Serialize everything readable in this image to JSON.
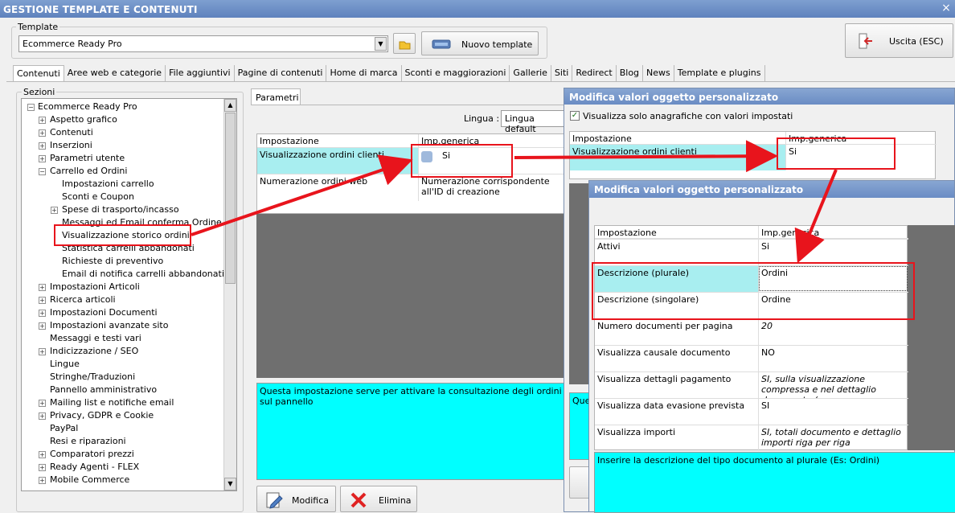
{
  "window": {
    "title": "GESTIONE TEMPLATE E CONTENUTI",
    "close": "×"
  },
  "template": {
    "label": "Template",
    "value": "Ecommerce Ready Pro",
    "new_button": "Nuovo template"
  },
  "exit_button": "Uscita (ESC)",
  "tabs": [
    "Contenuti",
    "Aree web e categorie",
    "File aggiuntivi",
    "Pagine di contenuti",
    "Home di marca",
    "Sconti e maggiorazioni",
    "Gallerie",
    "Siti",
    "Redirect",
    "Blog",
    "News",
    "Template e plugins"
  ],
  "sections": {
    "label": "Sezioni",
    "root": "Ecommerce Ready Pro",
    "items": [
      {
        "label": "Aspetto grafico",
        "exp": "+"
      },
      {
        "label": "Contenuti",
        "exp": "+"
      },
      {
        "label": "Inserzioni",
        "exp": "+"
      },
      {
        "label": "Parametri utente",
        "exp": "+"
      },
      {
        "label": "Carrello ed Ordini",
        "exp": "−"
      },
      {
        "label": "Impostazioni carrello",
        "exp": ""
      },
      {
        "label": "Sconti e Coupon",
        "exp": ""
      },
      {
        "label": "Spese di trasporto/incasso",
        "exp": "+"
      },
      {
        "label": "Messaggi ed Email conferma Ordine",
        "exp": ""
      },
      {
        "label": "Visualizzazione storico ordini",
        "exp": ""
      },
      {
        "label": "Statistica carrelli abbandonati",
        "exp": ""
      },
      {
        "label": "Richieste di preventivo",
        "exp": ""
      },
      {
        "label": "Email di notifica carrelli abbandonati",
        "exp": ""
      },
      {
        "label": "Impostazioni Articoli",
        "exp": "+"
      },
      {
        "label": "Ricerca articoli",
        "exp": "+"
      },
      {
        "label": "Impostazioni Documenti",
        "exp": "+"
      },
      {
        "label": "Impostazioni avanzate sito",
        "exp": "+"
      },
      {
        "label": "Messaggi e testi vari",
        "exp": ""
      },
      {
        "label": "Indicizzazione / SEO",
        "exp": "+"
      },
      {
        "label": "Lingue",
        "exp": ""
      },
      {
        "label": "Stringhe/Traduzioni",
        "exp": ""
      },
      {
        "label": "Pannello amministrativo",
        "exp": ""
      },
      {
        "label": "Mailing list e notifiche email",
        "exp": "+"
      },
      {
        "label": "Privacy, GDPR e Cookie",
        "exp": "+"
      },
      {
        "label": "PayPal",
        "exp": ""
      },
      {
        "label": "Resi e riparazioni",
        "exp": ""
      },
      {
        "label": "Comparatori prezzi",
        "exp": "+"
      },
      {
        "label": "Ready Agenti - FLEX",
        "exp": "+"
      },
      {
        "label": "Mobile Commerce",
        "exp": "+"
      }
    ]
  },
  "params": {
    "tab": "Parametri",
    "lingua_label": "Lingua :",
    "lingua_value": "Lingua default",
    "col_setting": "Impostazione",
    "col_generic": "Imp.generica",
    "rows": [
      {
        "name": "Visualizzazione ordini clienti",
        "value": "Si"
      },
      {
        "name": "Numerazione ordini web",
        "value": "Numerazione corrispondente all'ID di creazione"
      }
    ],
    "description": "Questa impostazione serve per attivare la consultazione degli ordini sul pannello",
    "modify_button": "Modifica",
    "delete_button": "Elimina"
  },
  "dialog1": {
    "title": "Modifica valori oggetto personalizzato",
    "checkbox": "Visualizza solo anagrafiche con valori impostati",
    "col_setting": "Impostazione",
    "col_generic": "Imp.generica",
    "row_name": "Visualizzazione ordini clienti",
    "row_value": "Si",
    "desc_fragment": "Ques"
  },
  "dialog2": {
    "title": "Modifica valori oggetto personalizzato",
    "col_setting": "Impostazione",
    "col_generic": "Imp.generica",
    "rows": [
      {
        "name": "Attivi",
        "value": "Si",
        "italic": false
      },
      {
        "name": "Descrizione (plurale)",
        "value": "Ordini",
        "italic": false
      },
      {
        "name": "Descrizione (singolare)",
        "value": "Ordine",
        "italic": false
      },
      {
        "name": "Numero documenti per pagina",
        "value": "20",
        "italic": true
      },
      {
        "name": "Visualizza causale documento",
        "value": "NO",
        "italic": false
      },
      {
        "name": "Visualizza dettagli pagamento",
        "value": "SI, sulla visualizzazione compressa e nel dettaglio documento (compresse…",
        "italic": true
      },
      {
        "name": "Visualizza data evasione prevista",
        "value": "SI",
        "italic": false
      },
      {
        "name": "Visualizza importi",
        "value": "SI, totali documento e dettaglio importi riga per riga",
        "italic": true
      }
    ],
    "description": "Inserire la descrizione del tipo documento al plurale (Es: Ordini)"
  },
  "colors": {
    "highlight": "#a8eef0",
    "cyan": "#00ffff",
    "annotation": "#e8141c",
    "title": "#6a8cc4"
  }
}
